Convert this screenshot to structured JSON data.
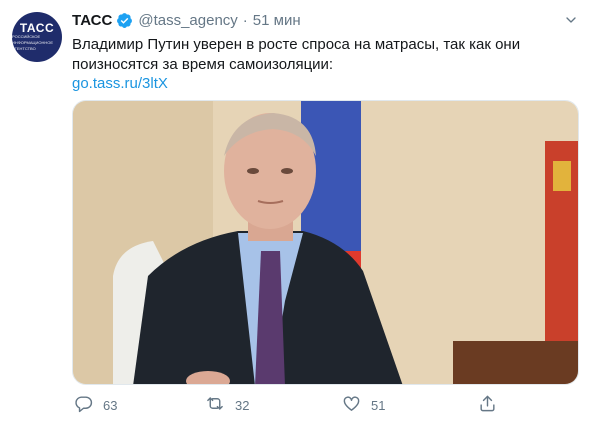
{
  "account": {
    "avatar_text": "ТАСС",
    "avatar_subtext": "РОССИЙСКОЕ ИНФОРМАЦИОННОЕ АГЕНТСТВО",
    "name": "ТАСС",
    "handle": "@tass_agency",
    "separator": "·",
    "time": "51 мин"
  },
  "tweet": {
    "text": "Владимир Путин уверен в росте спроса на матрасы, так как они поизносятся за время самоизоляции:",
    "link": "go.tass.ru/3ltX"
  },
  "actions": {
    "replies": "63",
    "retweets": "32",
    "likes": "51"
  },
  "icons": {
    "verified": "verified-badge-icon",
    "menu": "chevron-down-icon",
    "reply": "reply-icon",
    "retweet": "retweet-icon",
    "like": "heart-icon",
    "share": "share-icon"
  },
  "colors": {
    "link": "#1b95e0",
    "secondary": "#657786",
    "verified": "#1da1f2",
    "avatar_bg": "#1f2c6b"
  }
}
